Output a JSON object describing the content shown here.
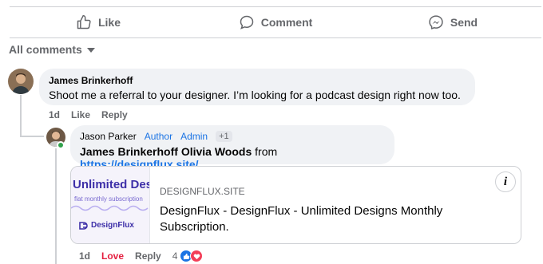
{
  "actions": {
    "like": "Like",
    "comment": "Comment",
    "send": "Send"
  },
  "all_comments": "All comments",
  "comment1": {
    "author": "James Brinkerhoff",
    "text": "Shoot me a referral to your designer. I’m looking for a podcast design right now too.",
    "time": "1d",
    "like": "Like",
    "reply": "Reply"
  },
  "reply1": {
    "author": "Jason Parker",
    "badge_author": "Author",
    "badge_admin": "Admin",
    "badge_plus": "+1",
    "mentions": "James Brinkerhoff Olivia Woods",
    "from_word": "from",
    "link": "https://designflux.site/",
    "preview": {
      "thumb_title": "Unlimited Design",
      "thumb_sub": "flat monthly subscription",
      "thumb_logo": "DesignFlux",
      "domain": "DESIGNFLUX.SITE",
      "title": "DesignFlux - DesignFlux - Unlimited Designs Monthly Subscription.",
      "info": "i"
    },
    "time": "1d",
    "love": "Love",
    "reply": "Reply",
    "reaction_count": "4"
  },
  "colors": {
    "accent": "#1b74e4",
    "love": "#e41e3f",
    "muted": "#65676b",
    "bubble": "#f0f2f5"
  }
}
